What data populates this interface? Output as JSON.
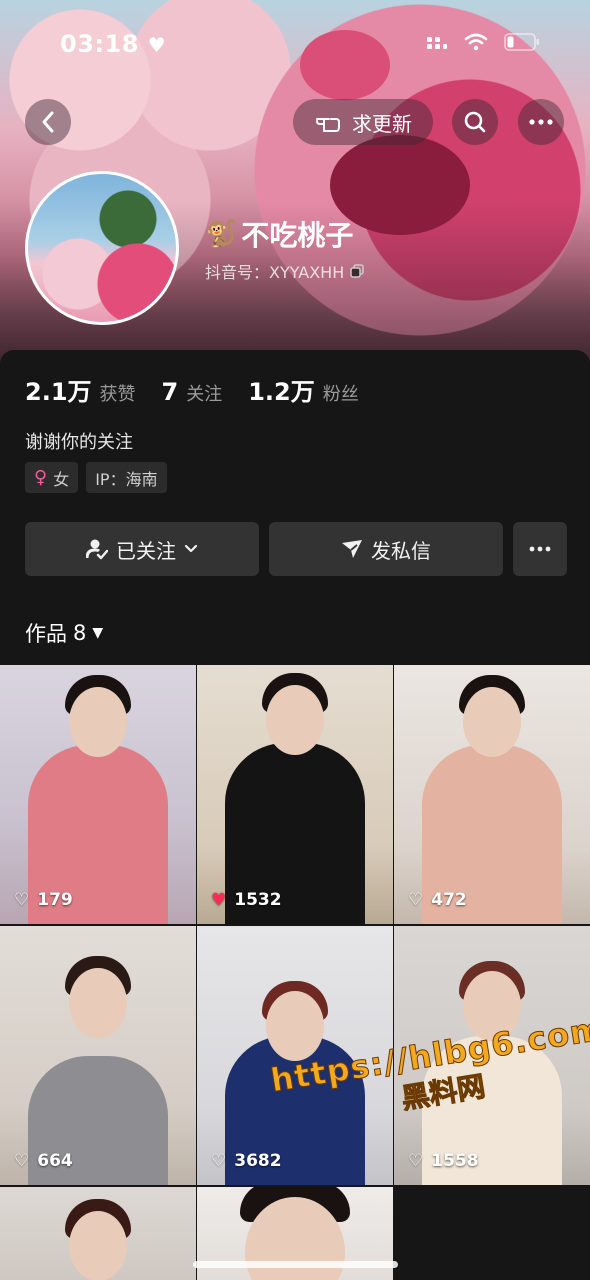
{
  "status_bar": {
    "time": "03:18"
  },
  "header": {
    "update_label": "求更新",
    "username": "不吃桃子",
    "douyin_id": "抖音号：XYYAXHH"
  },
  "stats": [
    {
      "value": "2.1万",
      "label": "获赞"
    },
    {
      "value": "7",
      "label": "关注"
    },
    {
      "value": "1.2万",
      "label": "粉丝"
    }
  ],
  "bio": "谢谢你的关注",
  "tags": {
    "gender": "女",
    "ip": "IP：海南"
  },
  "actions": {
    "follow_label": "已关注",
    "message_label": "发私信"
  },
  "works": {
    "label": "作品",
    "count": "8"
  },
  "videos": [
    {
      "likes": "179",
      "liked": false
    },
    {
      "likes": "1532",
      "liked": true
    },
    {
      "likes": "472",
      "liked": false
    },
    {
      "likes": "664",
      "liked": false
    },
    {
      "likes": "3682",
      "liked": false
    },
    {
      "likes": "1558",
      "liked": false
    }
  ],
  "watermark": {
    "url": "https://hlbg6.com",
    "name": "黑料网"
  },
  "colors": {
    "accent_like": "#fe2c55",
    "female": "#f35b9b",
    "watermark": "#f3a81d"
  }
}
